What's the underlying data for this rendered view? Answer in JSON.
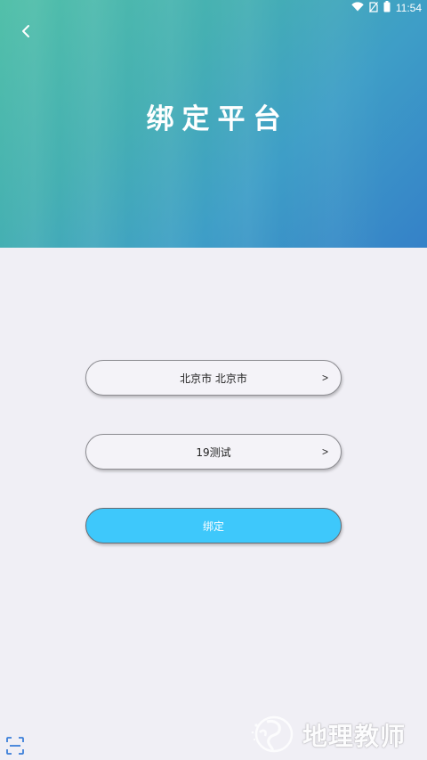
{
  "status_bar": {
    "time": "11:54",
    "icons": [
      "wifi-icon",
      "no-sim-icon",
      "battery-icon"
    ]
  },
  "header": {
    "title": "绑定平台",
    "back_icon": "chevron-left-icon"
  },
  "form": {
    "region_value": "北京市 北京市",
    "region_arrow": ">",
    "platform_value": "19测试",
    "platform_arrow": ">",
    "bind_label": "绑定"
  },
  "footer": {
    "scan_icon": "scan-icon",
    "watermark_text": "地理教师"
  },
  "colors": {
    "header_gradient_start": "#52c0a9",
    "header_gradient_end": "#3581c8",
    "page_background": "#f0eff5",
    "bind_button": "#3ec8fb"
  }
}
